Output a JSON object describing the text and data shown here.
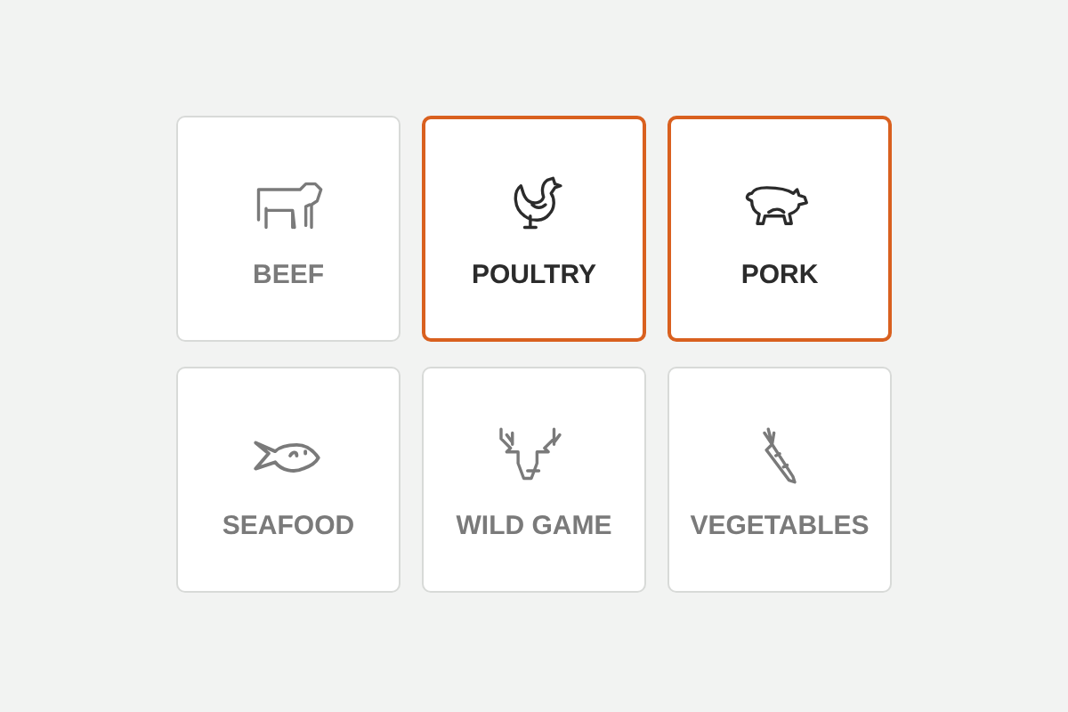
{
  "categories": [
    {
      "label": "BEEF",
      "kind": "cow",
      "selected": false
    },
    {
      "label": "POULTRY",
      "kind": "chicken",
      "selected": true
    },
    {
      "label": "PORK",
      "kind": "pig",
      "selected": true
    },
    {
      "label": "SEAFOOD",
      "kind": "fish",
      "selected": false
    },
    {
      "label": "WILD GAME",
      "kind": "deer",
      "selected": false
    },
    {
      "label": "VEGETABLES",
      "kind": "carrot",
      "selected": false
    }
  ]
}
